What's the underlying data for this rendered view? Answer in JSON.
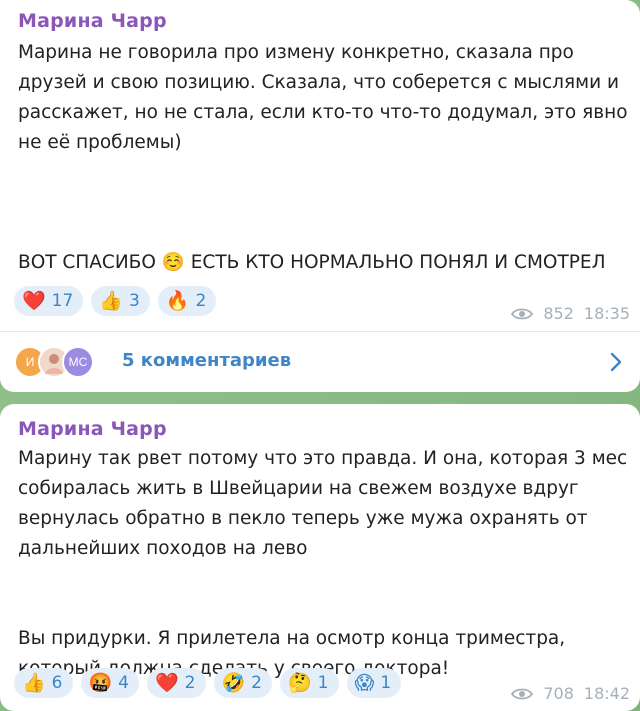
{
  "posts": [
    {
      "author": "Марина Чарр",
      "text": "Марина не говорила про измену конкретно, сказала про друзей и свою позицию. Сказала, что соберется с мыслями и расскажет, но не стала, если кто-то что-то додумал, это явно не её проблемы)\n\n\n\nВОТ СПАСИБО ☺️ ЕСТЬ КТО НОРМАЛЬНО ПОНЯЛ И СМОТРЕЛ",
      "reactions": [
        {
          "emoji": "❤️",
          "icon": "heart-icon",
          "count": "17"
        },
        {
          "emoji": "👍",
          "icon": "thumbs-up-icon",
          "count": "3"
        },
        {
          "emoji": "🔥",
          "icon": "fire-icon",
          "count": "2"
        }
      ],
      "views": "852",
      "time": "18:35",
      "comments": {
        "avatar_initials": [
          "И",
          "",
          "МС"
        ],
        "label": "5 комментариев"
      }
    },
    {
      "author": "Марина Чарр",
      "text": "Марину так рвет потому что это правда. И она, которая 3 мес собиралась жить в Швейцарии на свежем воздухе вдруг вернулась обратно в пекло теперь уже мужа охранять от дальнейших походов на лево\n\n\nВы придурки. Я прилетела на осмотр конца триместра, который должна сделать у своего доктора!",
      "reactions": [
        {
          "emoji": "👍",
          "icon": "thumbs-up-icon",
          "count": "6"
        },
        {
          "emoji": "🤬",
          "icon": "angry-face-icon",
          "count": "4"
        },
        {
          "emoji": "❤️",
          "icon": "heart-icon",
          "count": "2"
        },
        {
          "emoji": "🤣",
          "icon": "laughing-face-icon",
          "count": "2"
        },
        {
          "emoji": "🤔",
          "icon": "thinking-face-icon",
          "count": "1"
        },
        {
          "emoji": "😱",
          "icon": "screaming-face-icon",
          "count": "1"
        }
      ],
      "views": "708",
      "time": "18:42"
    }
  ],
  "colors": {
    "author": "#8a56b8",
    "reaction_bg": "#e3eef9",
    "reaction_text": "#3a85c8",
    "meta": "#a7b0ba",
    "link": "#3f86c7"
  }
}
